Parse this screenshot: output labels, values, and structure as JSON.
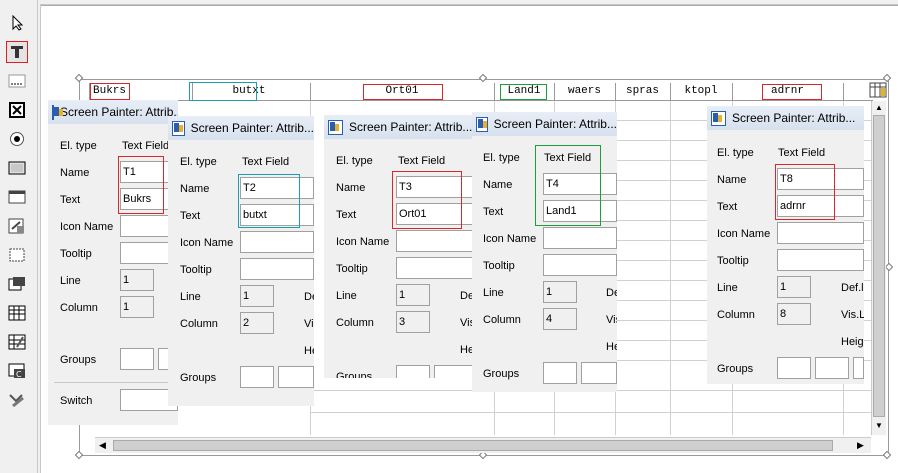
{
  "toolbar": {
    "tools": [
      {
        "icon": "pointer-icon"
      },
      {
        "icon": "text-field-icon"
      },
      {
        "icon": "input-field-icon"
      },
      {
        "icon": "checkbox-icon"
      },
      {
        "icon": "radio-button-icon"
      },
      {
        "icon": "pushbutton-icon"
      },
      {
        "icon": "box-icon"
      },
      {
        "icon": "subscreen-icon"
      },
      {
        "icon": "tabstrip-icon"
      },
      {
        "icon": "table-control-icon"
      },
      {
        "icon": "table-wizard-icon"
      },
      {
        "icon": "custom-control-icon"
      },
      {
        "icon": "status-icon"
      },
      {
        "icon": "tabstrip-wizard-icon"
      }
    ]
  },
  "table_header": {
    "columns": [
      {
        "label": "Bukrs"
      },
      {
        "label": "butxt"
      },
      {
        "label": "Ort01"
      },
      {
        "label": "Land1"
      },
      {
        "label": "waers"
      },
      {
        "label": "spras"
      },
      {
        "label": "ktopl"
      },
      {
        "label": "adrnr"
      }
    ]
  },
  "labels": {
    "el_type": "El. type",
    "text_field": "Text Field",
    "name": "Name",
    "text": "Text",
    "icon_name": "Icon Name",
    "tooltip": "Tooltip",
    "line": "Line",
    "column": "Column",
    "groups": "Groups",
    "switch": "Switch",
    "def": "Def.l",
    "vis": "Vis.L",
    "heig": "Heig",
    "def_short": "De",
    "vis_short": "Vis",
    "he_short": "He"
  },
  "windows": [
    {
      "title": "Screen Painter: Attrib...",
      "name": "T1",
      "text": "Bukrs",
      "line": "1",
      "column": "1"
    },
    {
      "title": "Screen Painter: Attrib...",
      "name": "T2",
      "text": "butxt",
      "line": "1",
      "column": "2"
    },
    {
      "title": "Screen Painter: Attrib...",
      "name": "T3",
      "text": "Ort01",
      "line": "1",
      "column": "3"
    },
    {
      "title": "Screen Painter: Attrib...",
      "name": "T4",
      "text": "Land1",
      "line": "1",
      "column": "4"
    },
    {
      "title": "Screen Painter: Attrib...",
      "name": "T8",
      "text": "adrnr",
      "line": "1",
      "column": "8"
    }
  ],
  "colors": {
    "red": "#d9262c",
    "teal": "#1f9bb0",
    "green": "#1e9e3a"
  }
}
